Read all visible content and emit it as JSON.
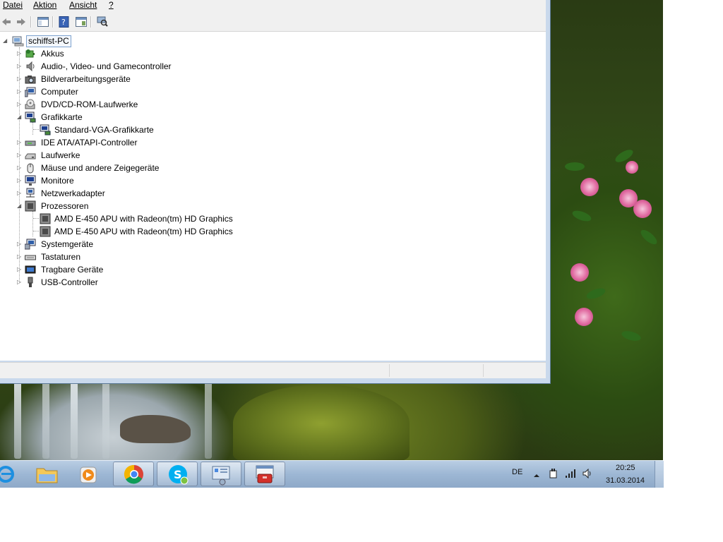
{
  "menubar": {
    "items": [
      "Datei",
      "Aktion",
      "Ansicht",
      "?"
    ]
  },
  "toolbar": {
    "buttons": [
      "back-icon",
      "forward-icon",
      "show-hide-tree-icon",
      "help-icon",
      "properties-icon",
      "scan-hardware-icon"
    ]
  },
  "tree": {
    "root": "schiffst-PC",
    "categories": [
      {
        "label": "Akkus",
        "icon": "battery-icon",
        "expanded": false
      },
      {
        "label": "Audio-, Video- und Gamecontroller",
        "icon": "speaker-icon",
        "expanded": false
      },
      {
        "label": "Bildverarbeitungsgeräte",
        "icon": "camera-icon",
        "expanded": false
      },
      {
        "label": "Computer",
        "icon": "computer-icon",
        "expanded": false
      },
      {
        "label": "DVD/CD-ROM-Laufwerke",
        "icon": "dvd-drive-icon",
        "expanded": false
      },
      {
        "label": "Grafikkarte",
        "icon": "display-adapter-icon",
        "expanded": true
      },
      {
        "label": "Standard-VGA-Grafikkarte",
        "icon": "display-adapter-icon",
        "child": true
      },
      {
        "label": "IDE ATA/ATAPI-Controller",
        "icon": "ide-controller-icon",
        "expanded": false
      },
      {
        "label": "Laufwerke",
        "icon": "disk-drive-icon",
        "expanded": false
      },
      {
        "label": "Mäuse und andere Zeigegeräte",
        "icon": "mouse-icon",
        "expanded": false
      },
      {
        "label": "Monitore",
        "icon": "monitor-icon",
        "expanded": false
      },
      {
        "label": "Netzwerkadapter",
        "icon": "network-adapter-icon",
        "expanded": false
      },
      {
        "label": "Prozessoren",
        "icon": "processor-icon",
        "expanded": true
      },
      {
        "label": "AMD E-450 APU with Radeon(tm) HD Graphics",
        "icon": "processor-icon",
        "child": true
      },
      {
        "label": "AMD E-450 APU with Radeon(tm) HD Graphics",
        "icon": "processor-icon",
        "child": true
      },
      {
        "label": "Systemgeräte",
        "icon": "system-devices-icon",
        "expanded": false
      },
      {
        "label": "Tastaturen",
        "icon": "keyboard-icon",
        "expanded": false
      },
      {
        "label": "Tragbare Geräte",
        "icon": "portable-device-icon",
        "expanded": false
      },
      {
        "label": "USB-Controller",
        "icon": "usb-icon",
        "expanded": false
      }
    ]
  },
  "taskbar": {
    "apps": [
      "internet-explorer-icon",
      "explorer-icon",
      "media-player-icon",
      "chrome-icon",
      "skype-icon",
      "control-panel-icon",
      "device-manager-icon"
    ],
    "language": "DE",
    "time": "20:25",
    "date": "31.03.2014"
  },
  "colors": {
    "selection_outline": "#7da2ce",
    "taskbar": "#9db7d4"
  }
}
